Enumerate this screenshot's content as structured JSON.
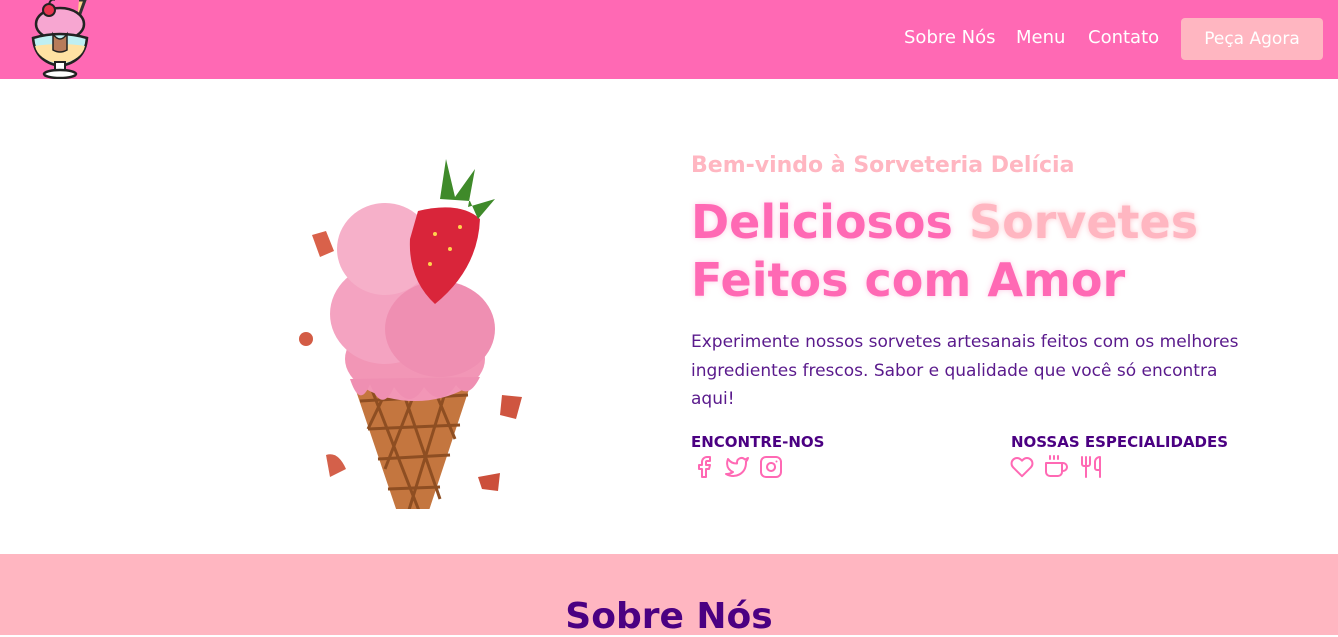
{
  "colors": {
    "primary": "#ff69b4",
    "light_pink": "#ffb6c1",
    "purple": "#4b0082",
    "text_purple": "#5a1a8c"
  },
  "nav": {
    "logo_icon": "ice-cream-sundae-icon",
    "links": [
      "Sobre Nós",
      "Menu",
      "Contato"
    ],
    "cta": "Peça Agora"
  },
  "hero": {
    "image_icon": "strawberry-ice-cream-cone-image",
    "welcome": "Bem-vindo à Sorveteria Delícia",
    "headline_1": "Deliciosos",
    "headline_accent": "Sorvetes",
    "headline_2": "Feitos com Amor",
    "description": "Experimente nossos sorvetes artesanais feitos com os melhores ingredientes frescos. Sabor e qualidade que você só encontra aqui!",
    "social_title": "ENCONTRE-NOS",
    "social_icons": [
      "facebook-icon",
      "twitter-icon",
      "instagram-icon"
    ],
    "specialties_title": "NOSSAS ESPECIALIDADES",
    "specialty_icons": [
      "heart-icon",
      "coffee-cup-icon",
      "utensils-icon"
    ]
  },
  "about": {
    "title": "Sobre Nós"
  }
}
